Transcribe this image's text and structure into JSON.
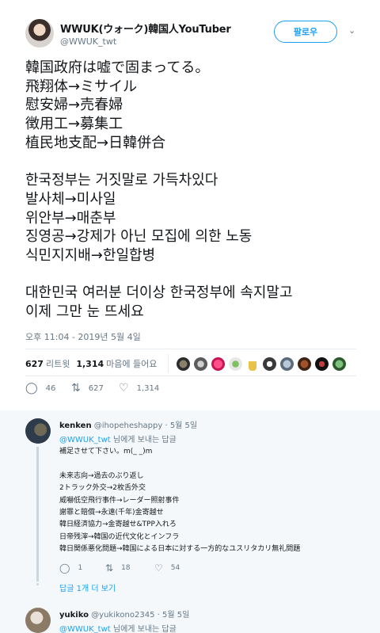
{
  "tweet": {
    "display_name": "WWUK(ウォーク)韓国人YouTuber",
    "handle": "@WWUK_twt",
    "follow_label": "팔로우",
    "caret_icon": "chevron-down-icon",
    "lines": [
      "韓国政府は嘘で固まってる。",
      "飛翔体→ミサイル",
      "慰安婦→売春婦",
      "徴用工→募集工",
      "植民地支配→日韓併合",
      "",
      "한국정부는 거짓말로 가득차있다",
      "발사체→미사일",
      "위안부→매춘부",
      "징영공→강제가 아닌 모집에 의한 노동",
      "식민지지배→한일합병",
      "",
      "대한민국 여러분 더이상 한국정부에 속지말고",
      "이제 그만 눈 뜨세요"
    ],
    "timestamp": "오후 11:04 - 2019년 5월 4일",
    "retweet_count": "627",
    "retweet_label": "리트윗",
    "like_count": "1,314",
    "like_label": "마음에 들어요",
    "actions": {
      "reply": "46",
      "retweet": "627",
      "like": "1,314"
    }
  },
  "replies": [
    {
      "name": "kenken",
      "meta": "@ihopeheshappy · 5월 5일",
      "reply_mention": "@WWUK_twt",
      "reply_suffix": " 님에게 보내는 답글",
      "lines": [
        "補足させて下さい。m(_ _)m",
        "",
        "未来志向→過去のぶり返し",
        "2トラック外交→2枚舌外交",
        "威嚇低空飛行事件→レーダー照射事件",
        "謝罪と賠償→永遠(千年)金寄越せ",
        "韓日経済協力→金寄越せ&TPP入れろ",
        "日帝残滓→韓国の近代文化とインフラ",
        "韓日関係悪化問題→韓国による日本に対する一方的なユスリタカリ無礼問題"
      ],
      "actions": {
        "reply": "1",
        "retweet": "18",
        "like": "54"
      },
      "more_label": "답글 1개 더 보기"
    },
    {
      "name": "yukiko",
      "meta": "@yukikono2345 · 5월 5일",
      "reply_mention": "@WWUK_twt",
      "reply_suffix": " 님에게 보내는 답글"
    }
  ],
  "colors": {
    "accent": "#1da1f2",
    "muted": "#657786",
    "text": "#14171a",
    "reply_bg": "#f5f8fa"
  }
}
